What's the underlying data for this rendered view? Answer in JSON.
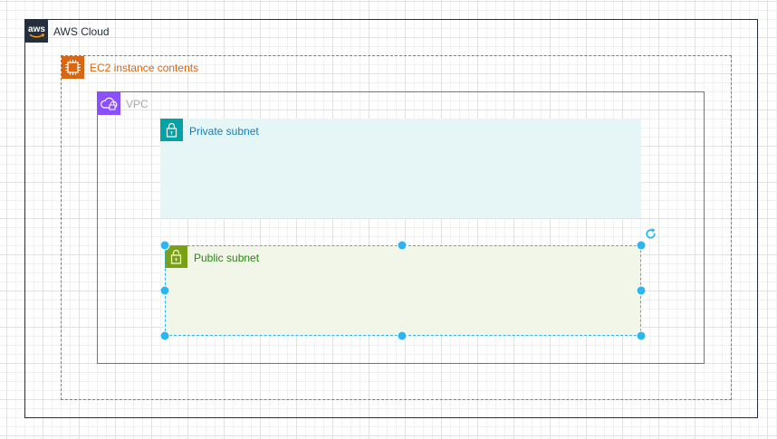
{
  "diagram": {
    "aws_cloud": {
      "label": "AWS Cloud",
      "icon": "aws-logo-icon",
      "logo_text": "aws",
      "color": "#232f3e"
    },
    "ec2_group": {
      "label": "EC2 instance contents",
      "icon": "ec2-chip-icon",
      "color": "#d86613"
    },
    "vpc": {
      "label": "VPC",
      "icon": "vpc-cloud-lock-icon",
      "color": "#8c4fff"
    },
    "private_subnet": {
      "label": "Private subnet",
      "icon": "lock-icon",
      "color": "#00a4a6",
      "fill": "#e6f6f7"
    },
    "public_subnet": {
      "label": "Public subnet",
      "icon": "unlock-icon",
      "color": "#7aa116",
      "fill": "#f2f6e8"
    },
    "selection": {
      "selected_element": "Public subnet",
      "handle_color": "#29b6f2"
    }
  }
}
